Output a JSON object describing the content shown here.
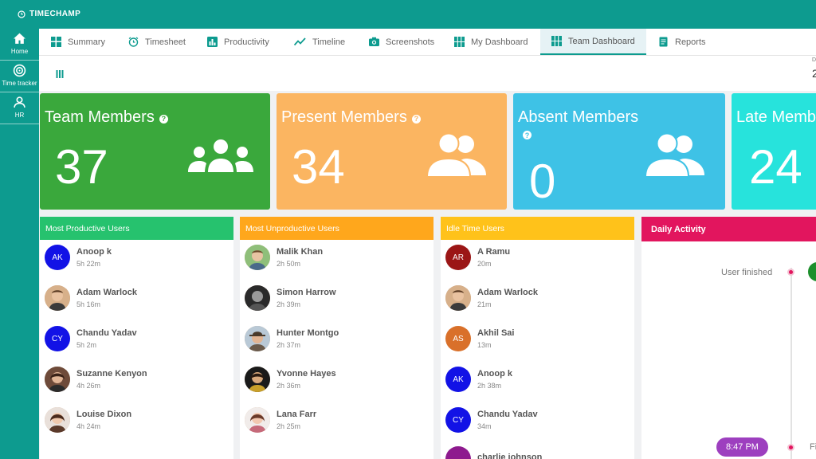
{
  "app": {
    "name": "TIMECHAMP"
  },
  "sidebar": {
    "items": [
      {
        "label": "Home",
        "icon": "home-icon"
      },
      {
        "label": "Time tracker",
        "icon": "time-tracker-icon"
      },
      {
        "label": "HR",
        "icon": "user-icon"
      }
    ]
  },
  "tabs": [
    {
      "label": "Summary",
      "icon": "grid-icon"
    },
    {
      "label": "Timesheet",
      "icon": "alarm-clock-icon"
    },
    {
      "label": "Productivity",
      "icon": "bar-chart-icon"
    },
    {
      "label": "Timeline",
      "icon": "trend-line-icon"
    },
    {
      "label": "Screenshots",
      "icon": "camera-icon"
    },
    {
      "label": "My Dashboard",
      "icon": "dashboard-grid-icon"
    },
    {
      "label": "Team Dashboard",
      "icon": "dashboard-grid-icon",
      "active": true
    },
    {
      "label": "Reports",
      "icon": "report-icon"
    }
  ],
  "subbar": {
    "edge_char": "D",
    "edge_num": "2"
  },
  "stats": [
    {
      "title": "Team Members",
      "value": "37",
      "color": "#3aa83c"
    },
    {
      "title": "Present Members",
      "value": "34",
      "color": "#fbb561"
    },
    {
      "title": "Absent Members",
      "value": "0",
      "color": "#3ec2e6"
    },
    {
      "title": "Late Members",
      "value": "24",
      "color": "#27e3dc"
    }
  ],
  "panels": [
    {
      "title": "Most Productive Users",
      "color": "#26c26e",
      "users": [
        {
          "name": "Anoop k",
          "time": "5h 22m",
          "initials": "AK",
          "avatar_color": "#1212e6"
        },
        {
          "name": "Adam Warlock",
          "time": "5h 16m",
          "initials": "",
          "avatar_color": ""
        },
        {
          "name": "Chandu Yadav",
          "time": "5h 2m",
          "initials": "CY",
          "avatar_color": "#1212e6"
        },
        {
          "name": "Suzanne Kenyon",
          "time": "4h 26m",
          "initials": "",
          "avatar_color": ""
        },
        {
          "name": "Louise Dixon",
          "time": "4h 24m",
          "initials": "",
          "avatar_color": ""
        }
      ]
    },
    {
      "title": "Most Unproductive Users",
      "color": "#ffa71c",
      "users": [
        {
          "name": "Malik Khan",
          "time": "2h 50m",
          "initials": "",
          "avatar_color": ""
        },
        {
          "name": "Simon Harrow",
          "time": "2h 39m",
          "initials": "",
          "avatar_color": ""
        },
        {
          "name": "Hunter Montgo",
          "time": "2h 37m",
          "initials": "",
          "avatar_color": ""
        },
        {
          "name": "Yvonne Hayes",
          "time": "2h 36m",
          "initials": "",
          "avatar_color": ""
        },
        {
          "name": "Lana Farr",
          "time": "2h 25m",
          "initials": "",
          "avatar_color": ""
        }
      ]
    },
    {
      "title": "Idle Time Users",
      "color": "#ffc21a",
      "users": [
        {
          "name": "A Ramu",
          "time": "20m",
          "initials": "AR",
          "avatar_color": "#9b1616"
        },
        {
          "name": "Adam Warlock",
          "time": "21m",
          "initials": "",
          "avatar_color": ""
        },
        {
          "name": "Akhil Sai",
          "time": "13m",
          "initials": "AS",
          "avatar_color": "#d9702a"
        },
        {
          "name": "Anoop k",
          "time": "2h 38m",
          "initials": "AK",
          "avatar_color": "#1212e6"
        },
        {
          "name": "Chandu Yadav",
          "time": "34m",
          "initials": "CY",
          "avatar_color": "#1212e6"
        },
        {
          "name": "charlie johnson",
          "time": "",
          "initials": "",
          "avatar_color": "#8e1a8e"
        }
      ]
    }
  ],
  "daily_activity": {
    "title": "Daily Activity",
    "event_label": "User finished",
    "time_pill": "8:47 PM",
    "edge_text": "Fi"
  }
}
